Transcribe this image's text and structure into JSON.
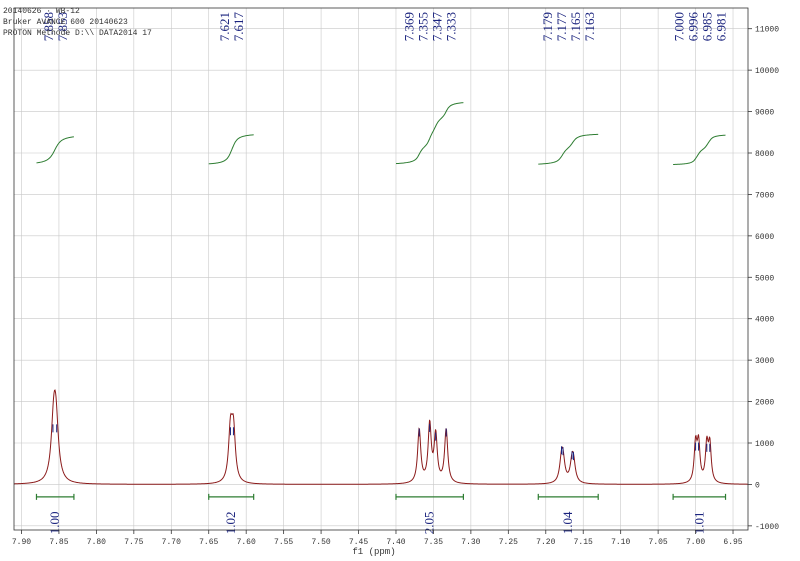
{
  "header": {
    "line1": "20140626 · WB-12",
    "line2": "Bruker AVANCE 600 20140623",
    "line3": "PROTON Methode D:\\\\ DATA2014 17"
  },
  "chart_data": {
    "type": "line",
    "title": "",
    "xlabel": "f1 (ppm)",
    "ylabel": "",
    "xlim": [
      7.91,
      6.93
    ],
    "ylim": [
      -1100,
      11500
    ],
    "x_reversed": true,
    "y_axis_side": "right",
    "x_ticks": [
      7.9,
      7.85,
      7.8,
      7.75,
      7.7,
      7.65,
      7.6,
      7.55,
      7.5,
      7.45,
      7.4,
      7.35,
      7.3,
      7.25,
      7.2,
      7.15,
      7.1,
      7.05,
      7.0,
      6.95
    ],
    "x_tick_labels": [
      "7.90",
      "7.85",
      "7.80",
      "7.75",
      "7.70",
      "7.65",
      "7.60",
      "7.55",
      "7.50",
      "7.45",
      "7.40",
      "7.35",
      "7.30",
      "7.25",
      "7.20",
      "7.15",
      "7.10",
      "7.05",
      "7.00",
      "6.95"
    ],
    "y_ticks": [
      -1000,
      0,
      1000,
      2000,
      3000,
      4000,
      5000,
      6000,
      7000,
      8000,
      9000,
      10000,
      11000
    ],
    "y_tick_labels": [
      "-1000",
      "0",
      "1000",
      "2000",
      "3000",
      "4000",
      "5000",
      "6000",
      "7000",
      "8000",
      "9000",
      "10000",
      "11000"
    ],
    "grid": true,
    "colors": {
      "spectrum": "#8b1a1a",
      "integral_curve": "#2e7d32",
      "integral_bracket": "#2e7d32",
      "labels": "#1a237e",
      "axis": "#333333",
      "grid": "#c8c8c8"
    },
    "peak_lines": [
      {
        "ppm": 7.858,
        "height": 1450
      },
      {
        "ppm": 7.853,
        "height": 1450
      },
      {
        "ppm": 7.621,
        "height": 1380
      },
      {
        "ppm": 7.617,
        "height": 1380
      },
      {
        "ppm": 7.369,
        "height": 1350
      },
      {
        "ppm": 7.355,
        "height": 1460
      },
      {
        "ppm": 7.347,
        "height": 1250
      },
      {
        "ppm": 7.333,
        "height": 1350
      },
      {
        "ppm": 7.179,
        "height": 920
      },
      {
        "ppm": 7.177,
        "height": 900
      },
      {
        "ppm": 7.165,
        "height": 800
      },
      {
        "ppm": 7.163,
        "height": 780
      },
      {
        "ppm": 7.0,
        "height": 1010
      },
      {
        "ppm": 6.996,
        "height": 1010
      },
      {
        "ppm": 6.985,
        "height": 980
      },
      {
        "ppm": 6.981,
        "height": 980
      }
    ],
    "peaks": [
      {
        "ppm": 7.857,
        "height": 1300,
        "width": 0.004
      },
      {
        "ppm": 7.854,
        "height": 1300,
        "width": 0.004
      },
      {
        "ppm": 7.621,
        "height": 1220,
        "width": 0.003
      },
      {
        "ppm": 7.617,
        "height": 1220,
        "width": 0.003
      },
      {
        "ppm": 7.369,
        "height": 1300,
        "width": 0.0025
      },
      {
        "ppm": 7.355,
        "height": 1400,
        "width": 0.0025
      },
      {
        "ppm": 7.347,
        "height": 1150,
        "width": 0.0025
      },
      {
        "ppm": 7.333,
        "height": 1300,
        "width": 0.0025
      },
      {
        "ppm": 7.179,
        "height": 480,
        "width": 0.003
      },
      {
        "ppm": 7.177,
        "height": 480,
        "width": 0.003
      },
      {
        "ppm": 7.165,
        "height": 420,
        "width": 0.003
      },
      {
        "ppm": 7.163,
        "height": 420,
        "width": 0.003
      },
      {
        "ppm": 7.0,
        "height": 930,
        "width": 0.0022
      },
      {
        "ppm": 6.996,
        "height": 930,
        "width": 0.0022
      },
      {
        "ppm": 6.985,
        "height": 900,
        "width": 0.0022
      },
      {
        "ppm": 6.981,
        "height": 900,
        "width": 0.0022
      }
    ],
    "peak_labels": [
      {
        "group": 1,
        "labels": [
          "7.858",
          "7.853"
        ]
      },
      {
        "group": 2,
        "labels": [
          "7.621",
          "7.617"
        ]
      },
      {
        "group": 3,
        "labels": [
          "7.369",
          "7.355",
          "7.347",
          "7.333"
        ]
      },
      {
        "group": 4,
        "labels": [
          "7.179",
          "7.177",
          "7.165",
          "7.163"
        ]
      },
      {
        "group": 5,
        "labels": [
          "7.000",
          "6.996",
          "6.985",
          "6.981"
        ]
      }
    ],
    "integrals": [
      {
        "from": 7.88,
        "to": 7.83,
        "value": "1.00",
        "curve_start": 7700,
        "curve_end": 8450
      },
      {
        "from": 7.65,
        "to": 7.59,
        "value": "1.02",
        "curve_start": 7700,
        "curve_end": 8480
      },
      {
        "from": 7.4,
        "to": 7.31,
        "value": "2.05",
        "curve_start": 7700,
        "curve_end": 9270
      },
      {
        "from": 7.21,
        "to": 7.13,
        "value": "1.04",
        "curve_start": 7700,
        "curve_end": 8480
      },
      {
        "from": 7.03,
        "to": 6.96,
        "value": "1.01",
        "curve_start": 7700,
        "curve_end": 8460
      }
    ]
  }
}
